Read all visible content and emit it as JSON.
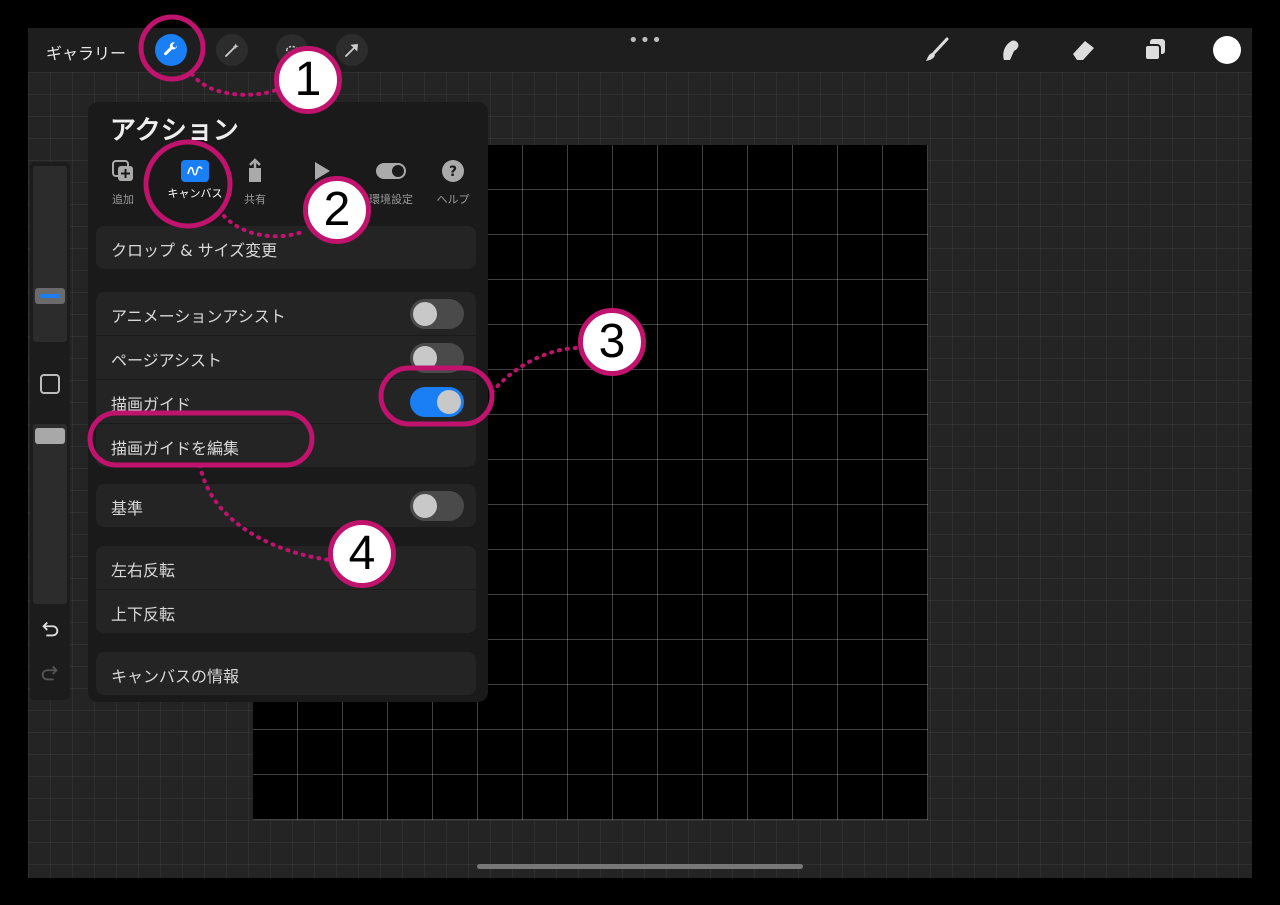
{
  "topbar": {
    "gallery_label": "ギャラリー",
    "more_label": "•••"
  },
  "actions_panel": {
    "title": "アクション",
    "tabs": [
      {
        "label": "追加",
        "icon": "add-icon",
        "active": false
      },
      {
        "label": "キャンバス",
        "icon": "canvas-icon",
        "active": true
      },
      {
        "label": "共有",
        "icon": "share-icon",
        "active": false
      },
      {
        "label": "",
        "icon": "video-icon",
        "active": false
      },
      {
        "label": "環境設定",
        "icon": "prefs-toggle-icon",
        "active": false
      },
      {
        "label": "ヘルプ",
        "icon": "help-icon",
        "active": false
      }
    ],
    "crop_resize": "クロップ & サイズ変更",
    "animation_assist": {
      "label": "アニメーションアシスト",
      "on": false
    },
    "page_assist": {
      "label": "ページアシスト",
      "on": false
    },
    "drawing_guide": {
      "label": "描画ガイド",
      "on": true
    },
    "edit_drawing_guide": "描画ガイドを編集",
    "reference": {
      "label": "基準",
      "on": false
    },
    "flip_horizontal": "左右反転",
    "flip_vertical": "上下反転",
    "canvas_info": "キャンバスの情報"
  },
  "callouts": [
    "1",
    "2",
    "3",
    "4"
  ],
  "colors": {
    "accent_blue": "#1a7ef5",
    "callout_magenta": "#c0136e",
    "panel_bg": "#1a1a1a",
    "current_color": "#ffffff"
  }
}
